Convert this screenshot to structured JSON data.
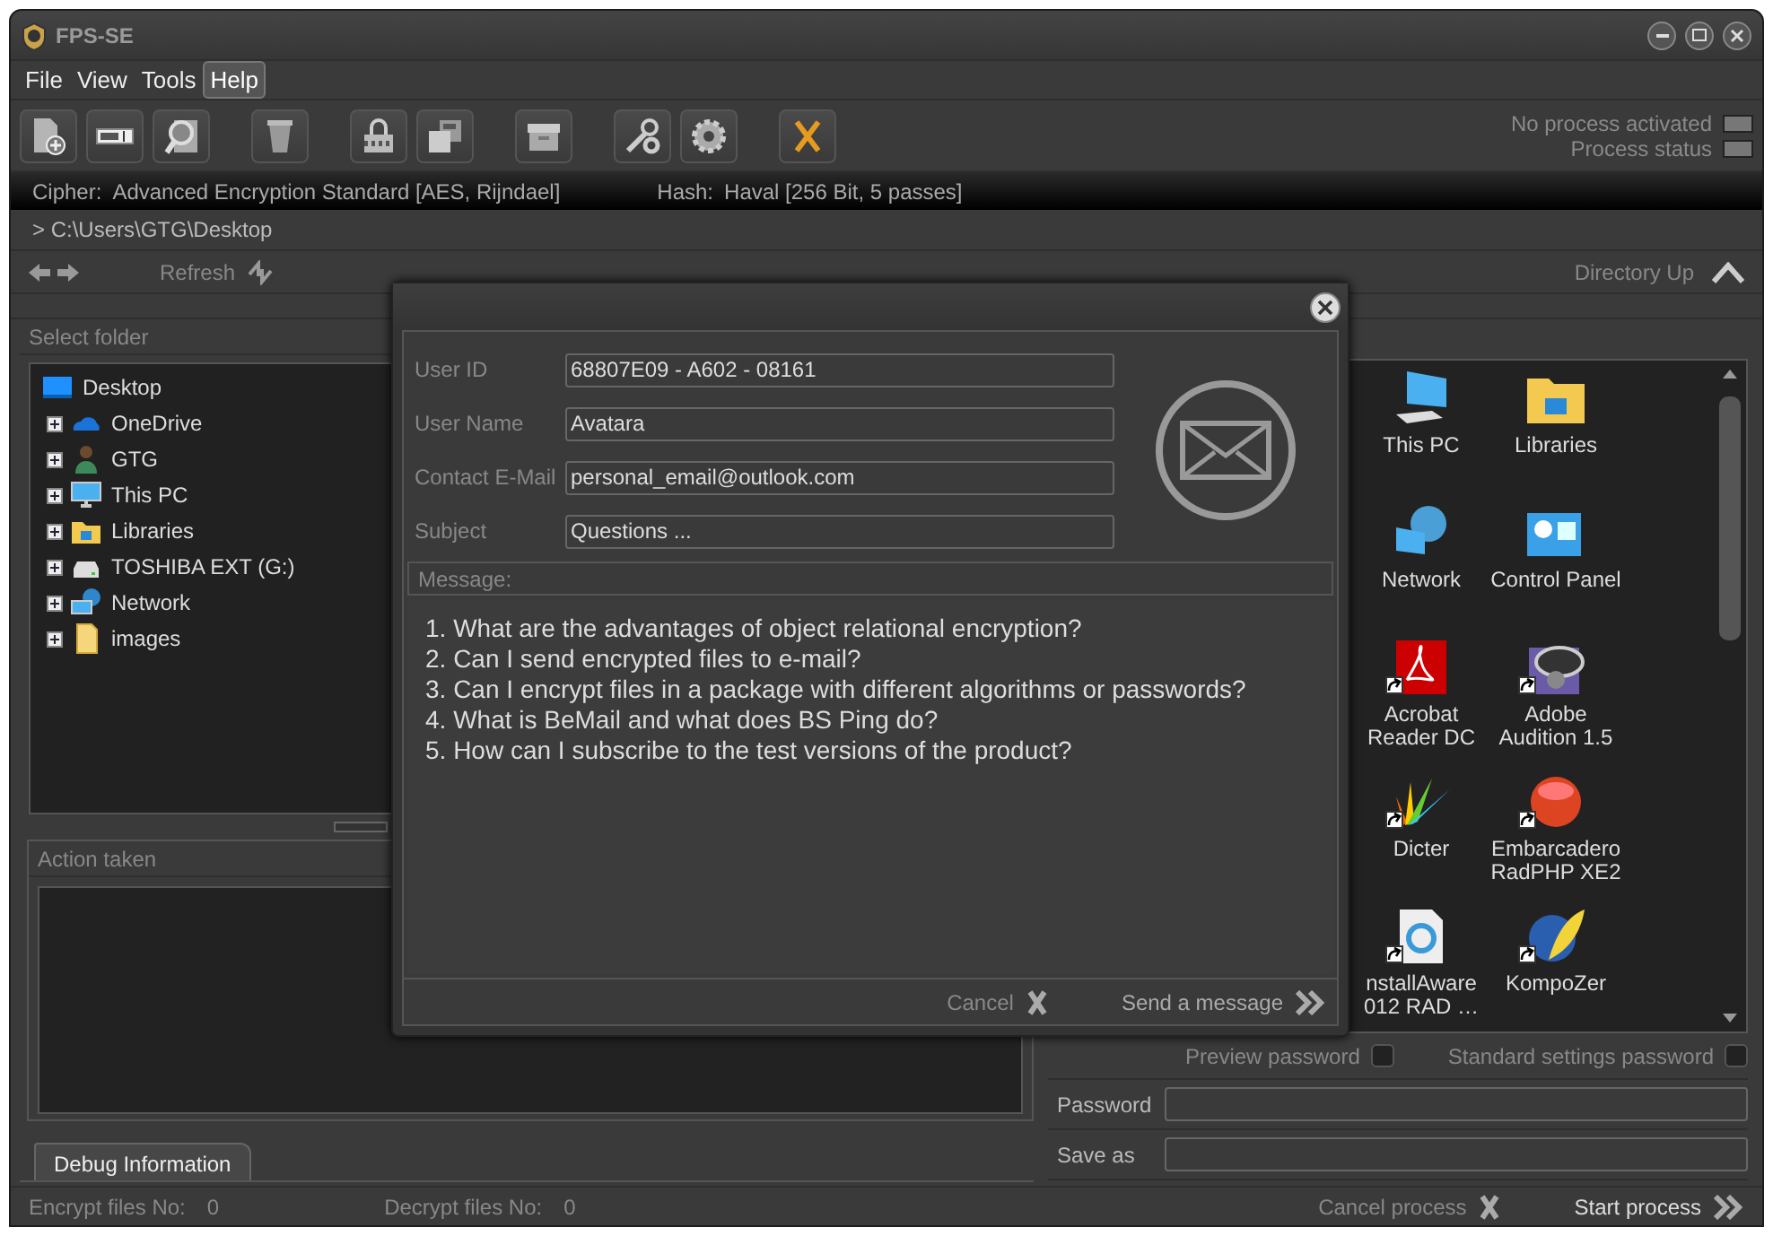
{
  "window": {
    "title": "FPS-SE"
  },
  "menu": [
    {
      "label": "File",
      "selected": false
    },
    {
      "label": "View",
      "selected": false
    },
    {
      "label": "Tools",
      "selected": false
    },
    {
      "label": "Help",
      "selected": true
    }
  ],
  "indicators": [
    {
      "label": "No process activated"
    },
    {
      "label": "Process status"
    }
  ],
  "cipher": {
    "label": "Cipher:",
    "value": "Advanced Encryption Standard [AES, Rijndael]"
  },
  "hash": {
    "label": "Hash:",
    "value": "Haval [256 Bit, 5 passes]"
  },
  "path": "> C:\\Users\\GTG\\Desktop",
  "nav": {
    "refresh": "Refresh",
    "directory_up": "Directory Up"
  },
  "folder_panel": {
    "title": "Select folder",
    "tree": [
      {
        "label": "Desktop",
        "kind": "desktop",
        "children": [
          {
            "label": "OneDrive",
            "kind": "cloud",
            "expanded": false
          },
          {
            "label": "GTG",
            "kind": "user",
            "expanded": false
          },
          {
            "label": "This PC",
            "kind": "pc",
            "expanded": false
          },
          {
            "label": "Libraries",
            "kind": "library",
            "expanded": false
          },
          {
            "label": "TOSHIBA EXT (G:)",
            "kind": "drive",
            "expanded": false
          },
          {
            "label": "Network",
            "kind": "network",
            "expanded": false
          },
          {
            "label": "images",
            "kind": "folder",
            "expanded": false
          }
        ]
      }
    ]
  },
  "action_panel": {
    "title": "Action taken"
  },
  "tabs": [
    {
      "label": "Debug Information",
      "selected": true
    }
  ],
  "files": [
    {
      "label": "This PC",
      "kind": "pc",
      "shortcut": false
    },
    {
      "label": "Libraries",
      "kind": "library",
      "shortcut": false
    },
    {
      "label": "Network",
      "kind": "network",
      "shortcut": false
    },
    {
      "label": "Control Panel",
      "kind": "control",
      "shortcut": false
    },
    {
      "label": "Acrobat\nReader DC",
      "kind": "pdf",
      "shortcut": true
    },
    {
      "label": "Adobe\nAudition 1.5",
      "kind": "speaker",
      "shortcut": true
    },
    {
      "label": "Dicter",
      "kind": "fan",
      "shortcut": true
    },
    {
      "label": "Embarcadero\nRadPHP XE2",
      "kind": "php",
      "shortcut": true
    },
    {
      "label": "nstallAware\n012 RAD …",
      "kind": "installer",
      "shortcut": true
    },
    {
      "label": "KompoZer",
      "kind": "feather",
      "shortcut": true
    }
  ],
  "options": [
    {
      "label": "Preview password",
      "checked": false
    },
    {
      "label": "Standard settings password",
      "checked": false
    }
  ],
  "password": {
    "label": "Password"
  },
  "save_as": {
    "label": "Save as"
  },
  "status_bar": {
    "encrypt_label": "Encrypt files No:",
    "encrypt_count": "0",
    "decrypt_label": "Decrypt files No:",
    "decrypt_count": "0",
    "cancel": "Cancel process",
    "start": "Start process"
  },
  "dialog": {
    "fields": [
      {
        "label": "User ID",
        "value": "68807E09 - A602 - 08161"
      },
      {
        "label": "User Name",
        "value": "Avatara"
      },
      {
        "label": "Contact E-Mail",
        "value": "personal_email@outlook.com"
      },
      {
        "label": "Subject",
        "value": "Questions ..."
      }
    ],
    "message_label": "Message:",
    "message": [
      "1. What are the advantages of object relational encryption?",
      "2. Can I send encrypted files to e-mail?",
      "3. Can I encrypt files in a package with different algorithms or passwords?",
      "4. What is BeMail and what does BS Ping do?",
      "5. How can I subscribe to the test versions of the product?"
    ],
    "cancel": "Cancel",
    "send": "Send a message"
  }
}
